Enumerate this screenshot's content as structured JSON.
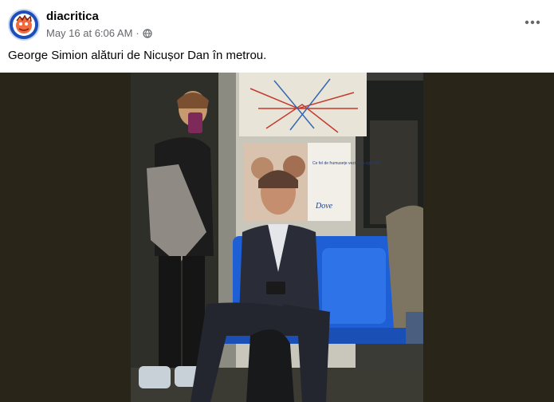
{
  "post": {
    "author": "diacritica",
    "timestamp": "May 16 at 6:06 AM",
    "separator": "·",
    "privacy_icon": "globe-icon",
    "caption": "George Simion alături de Nicușor Dan în metrou."
  },
  "photo": {
    "ad_text": "Ce fel de frumusețe vezi tu în oglindă?",
    "ad_brand": "Dove"
  },
  "colors": {
    "page_bg": "#ffffff",
    "media_bg": "#2a2519",
    "seat_blue": "#1f5fd6",
    "text_primary": "#050505",
    "text_secondary": "#65676b"
  }
}
